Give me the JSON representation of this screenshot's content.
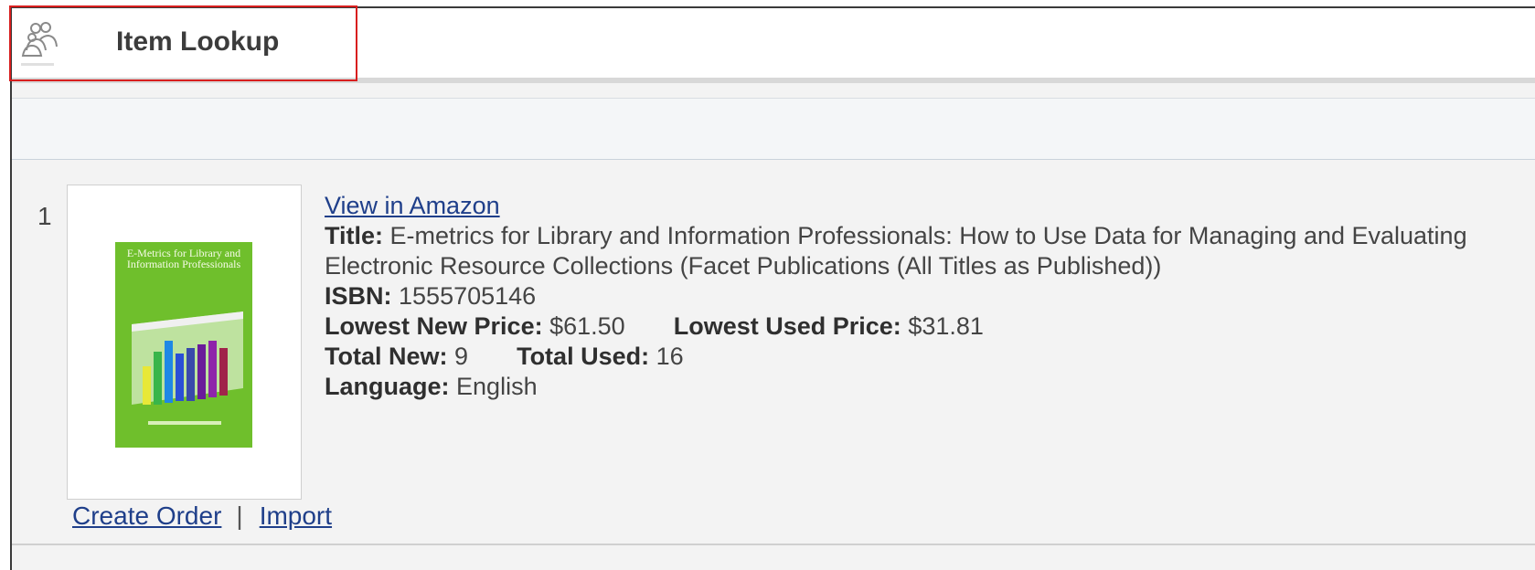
{
  "header": {
    "title": "Item Lookup",
    "icon": "users-icon"
  },
  "result": {
    "number": "1",
    "cover": {
      "title": "E-Metrics for Library and Information Professionals",
      "color": "#6fbf2c"
    },
    "view_link": "View in Amazon",
    "title_label": "Title:",
    "title_value": "E-metrics for Library and Information Professionals: How to Use Data for Managing and Evaluating Electronic Resource Collections (Facet Publications (All Titles as Published))",
    "isbn_label": "ISBN:",
    "isbn_value": "1555705146",
    "lowest_new_label": "Lowest New Price:",
    "lowest_new_value": "$61.50",
    "lowest_used_label": "Lowest Used Price:",
    "lowest_used_value": "$31.81",
    "total_new_label": "Total New:",
    "total_new_value": "9",
    "total_used_label": "Total Used:",
    "total_used_value": "16",
    "language_label": "Language:",
    "language_value": "English"
  },
  "actions": {
    "create_order": "Create Order",
    "separator": "|",
    "import": "Import"
  },
  "colors": {
    "highlight": "#d81e1e",
    "link": "#1f3f8a"
  }
}
